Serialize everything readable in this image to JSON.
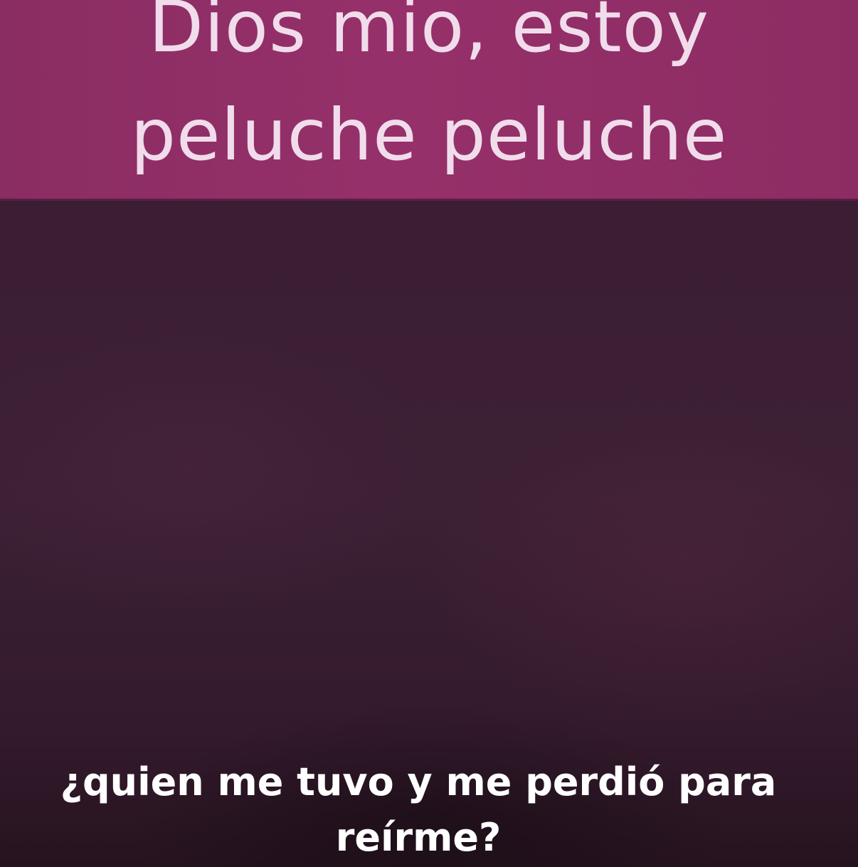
{
  "top_caption": {
    "line1": "Dios mio, estoy",
    "line2": "peluche peluche"
  },
  "bottom_caption": "¿quien me tuvo y me perdió para reírme?",
  "colors": {
    "banner": "#96306a",
    "banner_text": "#f1dcec",
    "background": "#3a1f30",
    "subtitle_text": "#ffffff"
  }
}
